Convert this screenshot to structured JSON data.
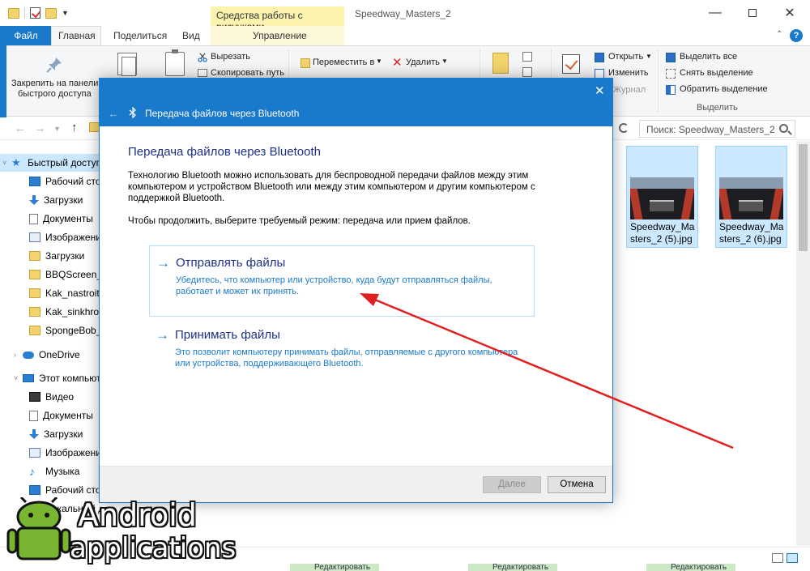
{
  "window": {
    "title": "Speedway_Masters_2",
    "context_tab_label": "Средства работы с рисунками"
  },
  "ribbon_tabs": {
    "file": "Файл",
    "home": "Главная",
    "share": "Поделиться",
    "view": "Вид",
    "manage": "Управление"
  },
  "ribbon": {
    "pin_line1": "Закрепить на панели",
    "pin_line2": "быстрого доступа",
    "cut": "Вырезать",
    "copy_path": "Скопировать путь",
    "move_to": "Переместить в",
    "delete": "Удалить",
    "open": "Открыть",
    "edit": "Изменить",
    "journal": "Журнал",
    "select_all": "Выделить все",
    "deselect": "Снять выделение",
    "invert_selection": "Обратить выделение",
    "group_select": "Выделить"
  },
  "search": {
    "placeholder": "Поиск: Speedway_Masters_2"
  },
  "nav_pane": {
    "items": [
      {
        "label": "Быстрый доступ"
      },
      {
        "label": "Рабочий стол"
      },
      {
        "label": "Загрузки"
      },
      {
        "label": "Документы"
      },
      {
        "label": "Изображения"
      },
      {
        "label": "Загрузки"
      },
      {
        "label": "BBQScreen_R"
      },
      {
        "label": "Kak_nastroit_"
      },
      {
        "label": "Kak_sinkhron"
      },
      {
        "label": "SpongeBob_C"
      },
      {
        "label": "OneDrive"
      },
      {
        "label": "Этот компьютер"
      },
      {
        "label": "Видео"
      },
      {
        "label": "Документы"
      },
      {
        "label": "Загрузки"
      },
      {
        "label": "Изображения"
      },
      {
        "label": "Музыка"
      },
      {
        "label": "Рабочий стол"
      },
      {
        "label": "Локальный диск (С"
      }
    ]
  },
  "files": [
    {
      "name": "Speedway_Masters_2 (5).jpg"
    },
    {
      "name": "Speedway_Masters_2 (6).jpg"
    }
  ],
  "status_bar": {
    "edit_chip": "Редактировать"
  },
  "watermark": {
    "line1": "Android",
    "line2": "applications"
  },
  "dialog": {
    "header_title": "Передача файлов через Bluetooth",
    "title": "Передача файлов через Bluetooth",
    "description": "Технологию Bluetooth можно использовать для беспроводной передачи файлов между этим компьютером и устройством Bluetooth или между этим компьютером и другим компьютером с поддержкой Bluetooth.",
    "prompt": "Чтобы продолжить, выберите требуемый режим: передача или прием файлов.",
    "options": [
      {
        "title": "Отправлять файлы",
        "description": "Убедитесь, что компьютер или устройство, куда будут отправляться файлы, работает и может их принять."
      },
      {
        "title": "Принимать файлы",
        "description": "Это позволит компьютеру принимать файлы, отправляемые с другого компьютера или устройства, поддерживающего Bluetooth."
      }
    ],
    "buttons": {
      "next": "Далее",
      "cancel": "Отмена"
    }
  },
  "colors": {
    "accent": "#1979ca",
    "heading": "#1e3287",
    "annotation_arrow": "#e02020",
    "context_tab": "#fbf2ad"
  }
}
